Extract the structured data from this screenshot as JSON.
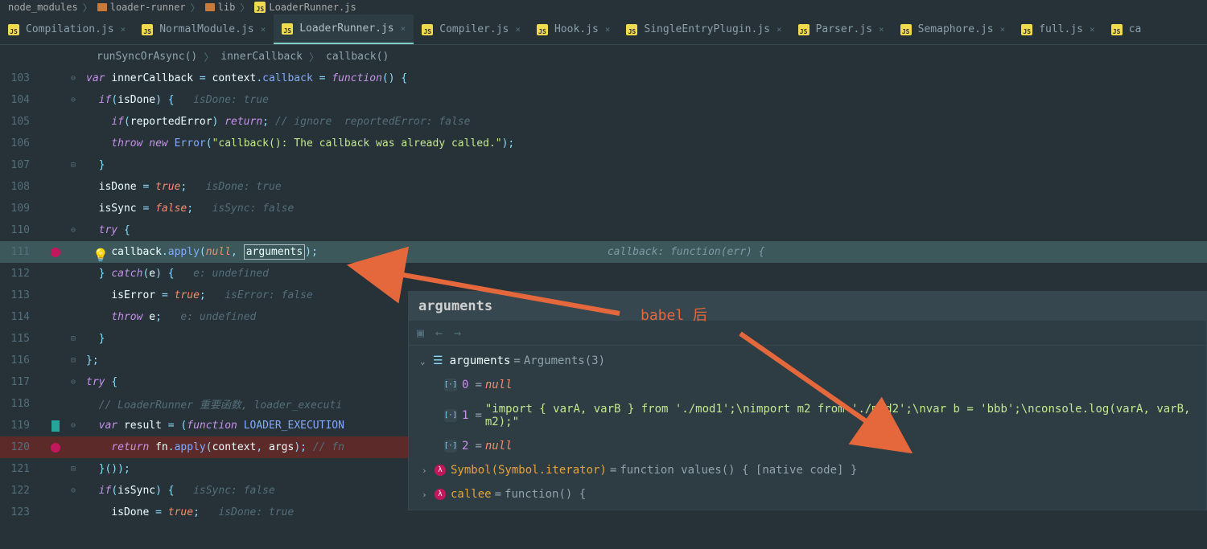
{
  "breadcrumb": {
    "items": [
      {
        "type": "folder",
        "label": "node_modules"
      },
      {
        "type": "folder",
        "label": "loader-runner"
      },
      {
        "type": "folder",
        "label": "lib"
      },
      {
        "type": "js",
        "label": "LoaderRunner.js"
      }
    ]
  },
  "tabs": [
    {
      "label": "Compilation.js",
      "active": false
    },
    {
      "label": "NormalModule.js",
      "active": false
    },
    {
      "label": "LoaderRunner.js",
      "active": true
    },
    {
      "label": "Compiler.js",
      "active": false
    },
    {
      "label": "Hook.js",
      "active": false
    },
    {
      "label": "SingleEntryPlugin.js",
      "active": false
    },
    {
      "label": "Parser.js",
      "active": false
    },
    {
      "label": "Semaphore.js",
      "active": false
    },
    {
      "label": "full.js",
      "active": false
    },
    {
      "label": "ca",
      "active": false
    }
  ],
  "navBreadcrumb": {
    "items": [
      "runSyncOrAsync()",
      "innerCallback",
      "callback()"
    ]
  },
  "code": {
    "line103": {
      "num": "103"
    },
    "line104": {
      "num": "104",
      "hint": "isDone: true"
    },
    "line105": {
      "num": "105",
      "hint": "// ignore  reportedError: false"
    },
    "line106": {
      "num": "106",
      "str": "\"callback(): The callback was already called.\""
    },
    "line107": {
      "num": "107"
    },
    "line108": {
      "num": "108",
      "hint": "isDone: true"
    },
    "line109": {
      "num": "109",
      "hint": "isSync: false"
    },
    "line110": {
      "num": "110"
    },
    "line111": {
      "num": "111",
      "arguments": "arguments",
      "debugHint": "callback: function(err) {"
    },
    "line112": {
      "num": "112",
      "hint": "e: undefined"
    },
    "line113": {
      "num": "113",
      "hint": "isError: false"
    },
    "line114": {
      "num": "114",
      "hint": "e: undefined"
    },
    "line115": {
      "num": "115"
    },
    "line116": {
      "num": "116"
    },
    "line117": {
      "num": "117"
    },
    "line118": {
      "num": "118",
      "comment": "// LoaderRunner 重要函数, loader_executi"
    },
    "line119": {
      "num": "119"
    },
    "line120": {
      "num": "120",
      "comment": "// fn"
    },
    "line121": {
      "num": "121"
    },
    "line122": {
      "num": "122",
      "hint": "isSync: false"
    },
    "line123": {
      "num": "123",
      "hint": "isDone: true"
    }
  },
  "babelLabel": "babel 后",
  "debug": {
    "title": "arguments",
    "rootLabel": "arguments",
    "rootValue": "Arguments(3)",
    "items": {
      "item0": {
        "idx": "0",
        "val": "null"
      },
      "item1": {
        "idx": "1",
        "val": "\"import { varA, varB } from './mod1';\\nimport m2 from './mod2';\\nvar b = 'bbb';\\nconsole.log(varA, varB, m2);\""
      },
      "item2": {
        "idx": "2",
        "val": "null"
      },
      "symbol": {
        "name": "Symbol(Symbol.iterator)",
        "val": "function values() { [native code] }"
      },
      "callee": {
        "name": "callee",
        "val": "function() {"
      }
    }
  }
}
